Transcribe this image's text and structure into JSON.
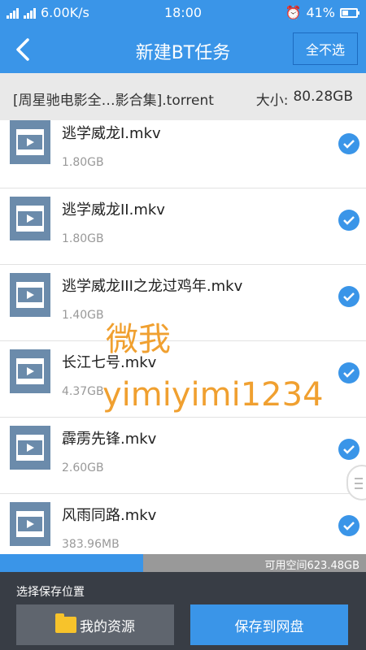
{
  "status": {
    "network_speed": "6.00K/s",
    "time": "18:00",
    "battery": "41%"
  },
  "header": {
    "title": "新建BT任务",
    "deselect_label": "全不选"
  },
  "torrent": {
    "name": "[周星驰电影全…影合集].torrent",
    "size_label": "大小:",
    "size_value": "80.28GB"
  },
  "files": [
    {
      "name": "逃学威龙I.mkv",
      "size": "1.80GB",
      "checked": true
    },
    {
      "name": "逃学威龙II.mkv",
      "size": "1.80GB",
      "checked": true
    },
    {
      "name": "逃学威龙III之龙过鸡年.mkv",
      "size": "1.40GB",
      "checked": true
    },
    {
      "name": "长江七号.mkv",
      "size": "4.37GB",
      "checked": true
    },
    {
      "name": "霹雳先锋.mkv",
      "size": "2.60GB",
      "checked": true
    },
    {
      "name": "风雨同路.mkv",
      "size": "383.96MB",
      "checked": true
    }
  ],
  "watermark": {
    "line1": "微我",
    "line2": "yimiyimi1234"
  },
  "storage": {
    "available_text": "可用空间623.48GB",
    "used_fraction": 0.39
  },
  "bottom": {
    "location_label": "选择保存位置",
    "my_resources_label": "我的资源",
    "save_to_cloud_label": "保存到网盘"
  },
  "colors": {
    "accent": "#3a95e8",
    "bottom_bg": "#383d45",
    "watermark": "#f0a030"
  }
}
